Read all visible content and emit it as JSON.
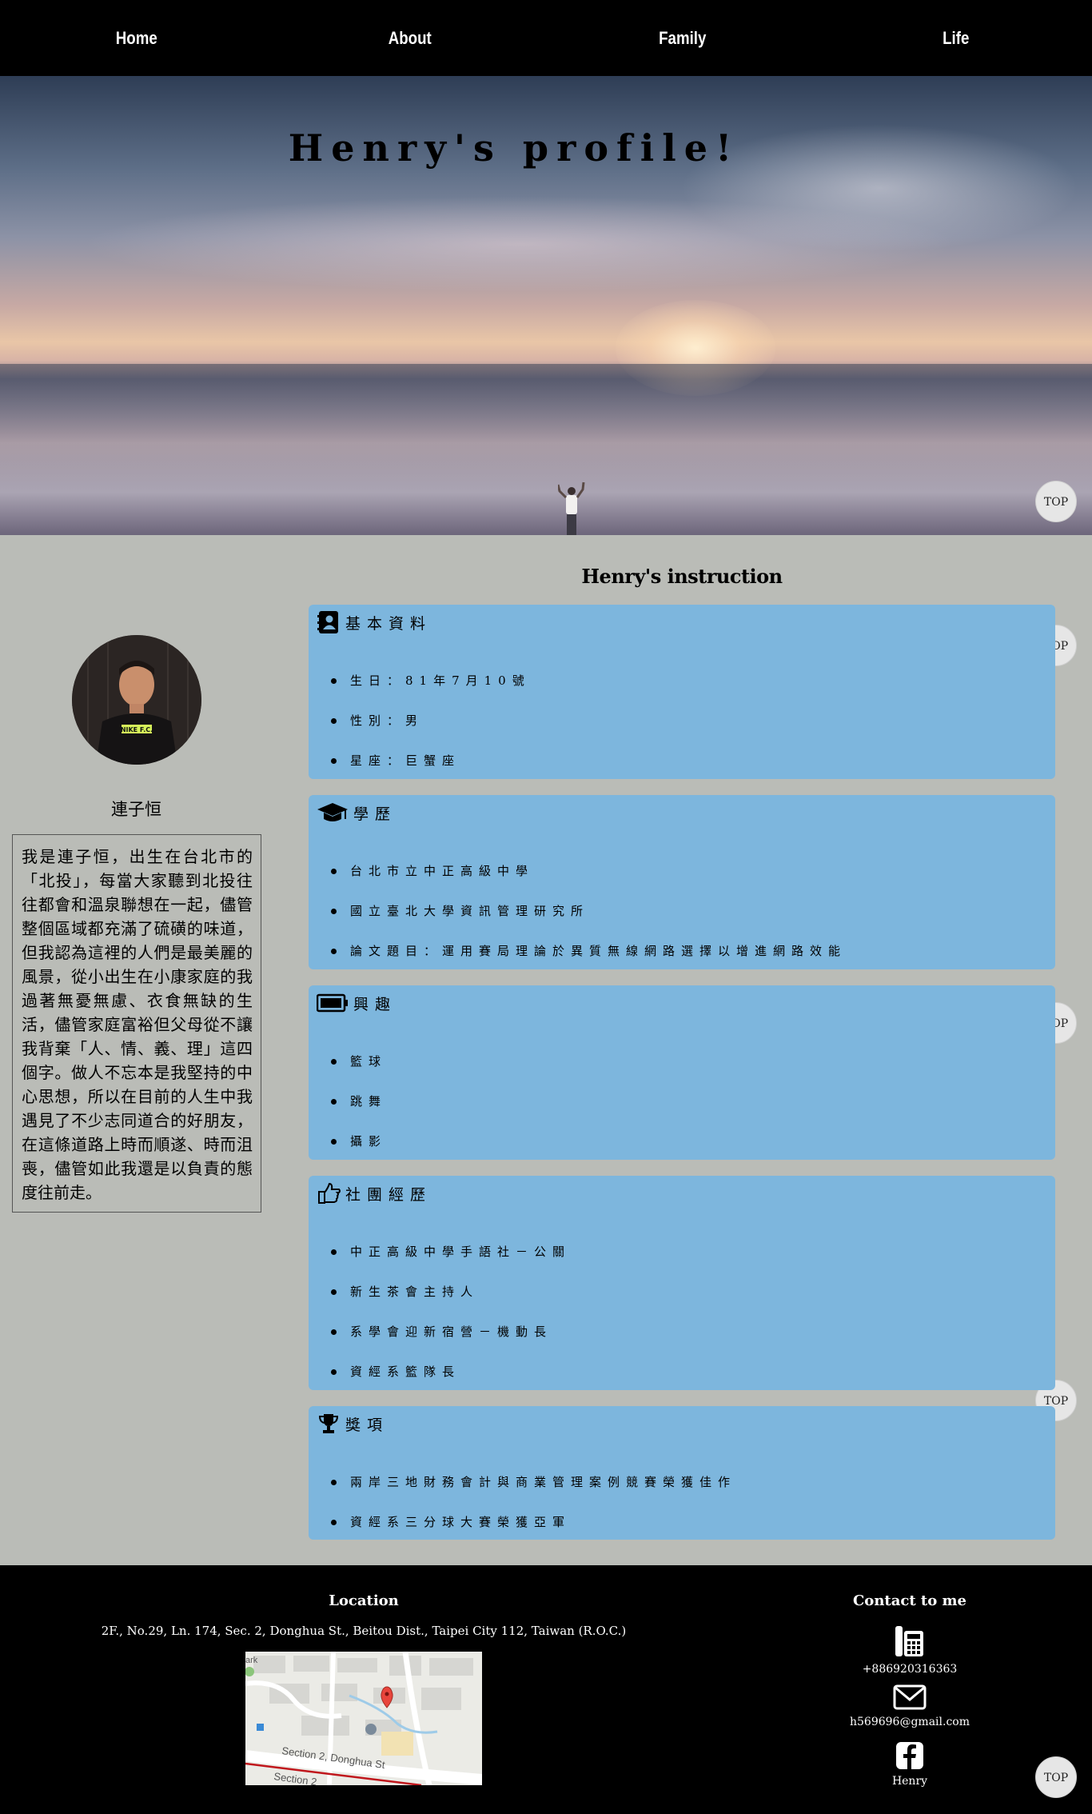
{
  "nav": {
    "items": [
      "Home",
      "About",
      "Family",
      "Life"
    ]
  },
  "hero": {
    "title": "Henry's profile!"
  },
  "top_label": "TOP",
  "profile": {
    "name": "連子恒",
    "bio": "我是連子恒，出生在台北市的「北投」，每當大家聽到北投往往都會和溫泉聯想在一起，儘管整個區域都充滿了硫磺的味道，但我認為這裡的人們是最美麗的風景，從小出生在小康家庭的我過著無憂無慮、衣食無缺的生活，儘管家庭富裕但父母從不讓我背棄「人、情、義、理」這四個字。做人不忘本是我堅持的中心思想，所以在目前的人生中我遇見了不少志同道合的好朋友，在這條道路上時而順遂、時而沮喪，儘管如此我還是以負責的態度往前走。"
  },
  "instruction": {
    "title": "Henry's instruction",
    "sections": [
      {
        "icon": "contact-book-icon",
        "title": "基本資料",
        "items": [
          "生日：81年7月10號",
          "性別：男",
          "星座：巨蟹座"
        ]
      },
      {
        "icon": "graduation-cap-icon",
        "title": "學歷",
        "items": [
          "台北市立中正高級中學",
          "國立臺北大學資訊管理研究所",
          "論文題目：運用賽局理論於異質無線網路選擇以增進網路效能"
        ]
      },
      {
        "icon": "battery-icon",
        "title": "興趣",
        "items": [
          "籃球",
          "跳舞",
          "攝影"
        ]
      },
      {
        "icon": "hand-pointing-icon",
        "title": "社團經歷",
        "items": [
          "中正高級中學手語社－公關",
          "新生茶會主持人",
          "系學會迎新宿營－機動長",
          "資經系籃隊長"
        ]
      },
      {
        "icon": "trophy-icon",
        "title": "獎項",
        "items": [
          "兩岸三地財務會計與商業管理案例競賽榮獲佳作",
          "資經系三分球大賽榮獲亞軍"
        ]
      }
    ]
  },
  "footer": {
    "location_title": "Location",
    "address": "2F., No.29, Ln. 174, Sec. 2, Donghua St., Beitou Dist., Taipei City 112, Taiwan (R.O.C.)",
    "map_labels": [
      "Section 2, Donghua St",
      "Section 2",
      "ark"
    ],
    "contact_title": "Contact to me",
    "phone": "+886920316363",
    "email": "h569696@gmail.com",
    "facebook": "Henry"
  }
}
